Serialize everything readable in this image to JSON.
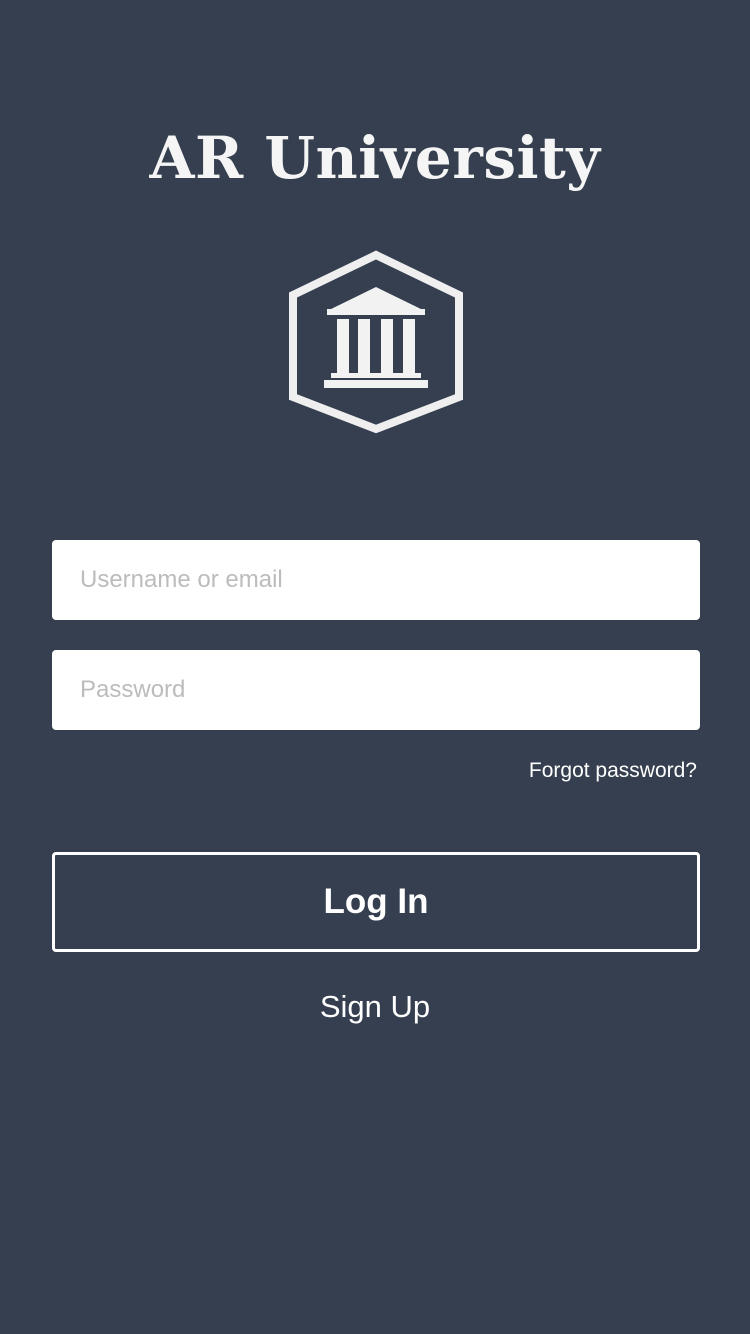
{
  "app": {
    "title": "AR University",
    "logo_icon": "university-building-hexagon-icon"
  },
  "form": {
    "username_placeholder": "Username or email",
    "username_value": "",
    "password_placeholder": "Password",
    "password_value": "",
    "forgot_label": "Forgot password?",
    "login_label": "Log In",
    "signup_label": "Sign Up"
  },
  "colors": {
    "background": "#353f4f",
    "text": "#ffffff",
    "input_background": "#ffffff",
    "placeholder": "#bcbcbc"
  }
}
